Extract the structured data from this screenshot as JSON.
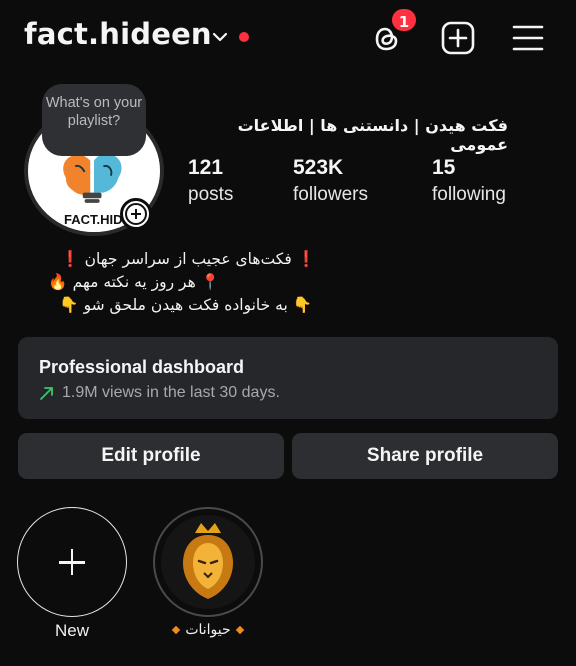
{
  "header": {
    "username": "fact.hideen",
    "notification_count": "1"
  },
  "avatar": {
    "logo_text": "FACT.HIDEN",
    "note_bubble": "What's on your playlist?"
  },
  "profile": {
    "full_name": "فکت هیدن | دانستنی ها | اطلاعات عمومی",
    "stats": [
      {
        "value": "121",
        "label": "posts"
      },
      {
        "value": "523K",
        "label": "followers"
      },
      {
        "value": "15",
        "label": "following"
      }
    ],
    "bio": [
      "❗ فکت‌های عجیب از سراسر جهان ❗",
      "📍 هر روز یه نکته مهم 🔥",
      "👇 به خانواده فکت هیدن ملحق شو 👇"
    ]
  },
  "dashboard": {
    "title": "Professional dashboard",
    "subtitle": "1.9M views in the last 30 days.",
    "accent": "#3ec46d"
  },
  "buttons": {
    "edit": "Edit profile",
    "share": "Share profile"
  },
  "highlights": [
    {
      "label": "New"
    },
    {
      "label": "حیوانات"
    }
  ],
  "colors": {
    "background": "#0c0c0c",
    "badge": "#ff3040",
    "card": "#26272b",
    "button": "#2d2e32"
  }
}
